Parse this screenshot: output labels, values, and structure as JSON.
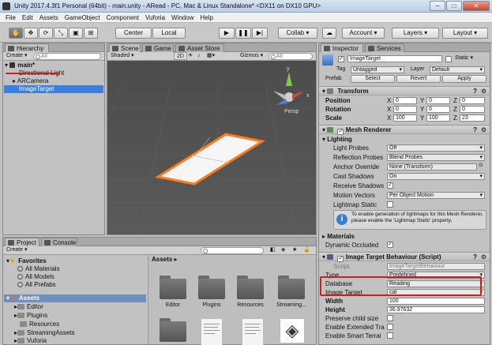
{
  "window": {
    "title": "Unity 2017.4.3f1 Personal (64bit) - main.unity - ARead - PC, Mac & Linux Standalone* <DX11 on DX10 GPU>",
    "min_label": "–",
    "max_label": "□",
    "close_label": "✕"
  },
  "menu": [
    "File",
    "Edit",
    "Assets",
    "GameObject",
    "Component",
    "Vuforia",
    "Window",
    "Help"
  ],
  "toolbar": {
    "pivot_center": "Center",
    "pivot_local": "Local",
    "collab": "Collab ▾",
    "account": "Account",
    "layers": "Layers",
    "layout": "Layout"
  },
  "hierarchy": {
    "tab": "Hierarchy",
    "create": "Create ▾",
    "search_placeholder": "All",
    "scene": "main*",
    "items": [
      "Directional Light",
      "ARCamera",
      "ImageTarget"
    ]
  },
  "scene_view": {
    "tabs": [
      "Scene",
      "Game",
      "Asset Store"
    ],
    "shading": "Shaded",
    "mode_2d": "2D",
    "gizmos": "Gizmos ▾",
    "search_placeholder": "All",
    "persp_label": "Persp",
    "axis_y": "y",
    "axis_x": "x"
  },
  "project": {
    "tabs": [
      "Project",
      "Console"
    ],
    "create": "Create ▾",
    "favorites_label": "Favorites",
    "favorites": [
      "All Materials",
      "All Models",
      "All Prefabs"
    ],
    "assets_label": "Assets",
    "asset_tree": [
      "Editor",
      "Plugins",
      "Resources",
      "StreamingAssets",
      "Vuforia"
    ],
    "breadcrumb": "Assets ▸",
    "grid": [
      "Editor",
      "Plugins",
      "Resources",
      "Streaming..."
    ]
  },
  "inspector": {
    "tabs": [
      "Inspector",
      "Services"
    ],
    "object_name": "ImageTarget",
    "static_label": "Static ▾",
    "tag_label": "Tag",
    "tag_value": "Untagged",
    "layer_label": "Layer",
    "layer_value": "Default",
    "prefab_label": "Prefab",
    "prefab_buttons": [
      "Select",
      "Revert",
      "Apply"
    ],
    "transform": {
      "title": "Transform",
      "position_label": "Position",
      "rotation_label": "Rotation",
      "scale_label": "Scale",
      "position": {
        "x": "0",
        "y": "0",
        "z": "0"
      },
      "rotation": {
        "x": "0",
        "y": "0",
        "z": "0"
      },
      "scale": {
        "x": "100",
        "y": "100",
        "z": "23"
      }
    },
    "mesh_renderer": {
      "title": "Mesh Renderer",
      "lighting": "Lighting",
      "rows": [
        {
          "label": "Light Probes",
          "value": "Off"
        },
        {
          "label": "Reflection Probes",
          "value": "Blend Probes"
        },
        {
          "label": "Anchor Override",
          "value": "None (Transform)"
        },
        {
          "label": "Cast Shadows",
          "value": "On"
        },
        {
          "label": "Receive Shadows",
          "value": "✓"
        },
        {
          "label": "Motion Vectors",
          "value": "Per Object Motion"
        },
        {
          "label": "Lightmap Static",
          "value": ""
        }
      ],
      "info": "To enable generation of lightmaps for this Mesh Renderer, please enable the 'Lightmap Static' property."
    },
    "materials_label": "Materials",
    "dynamic_occluded_label": "Dynamic Occluded",
    "dynamic_occluded_value": "✓",
    "image_target_behaviour": {
      "title": "Image Target Behaviour (Script)",
      "script_label": "Script",
      "script_value": "ImageTargetBehaviour",
      "type_label": "Type",
      "type_value": "Predefined",
      "database_label": "Database",
      "database_value": "Reading",
      "image_target_label": "Image Target",
      "image_target_value": "cat",
      "width_label": "Width",
      "width_value": "100",
      "height_label": "Height",
      "height_value": "36.97632",
      "preserve_label": "Preserve child size",
      "extended_label": "Enable Extended Tra",
      "smart_label": "Enable Smart Terrai"
    }
  },
  "colors": {
    "selection": "#3d7fdd",
    "highlight_red": "#cc1f1f",
    "plane_outline": "#ff7a1a",
    "scene_bg_top": "#4a4a4a"
  }
}
